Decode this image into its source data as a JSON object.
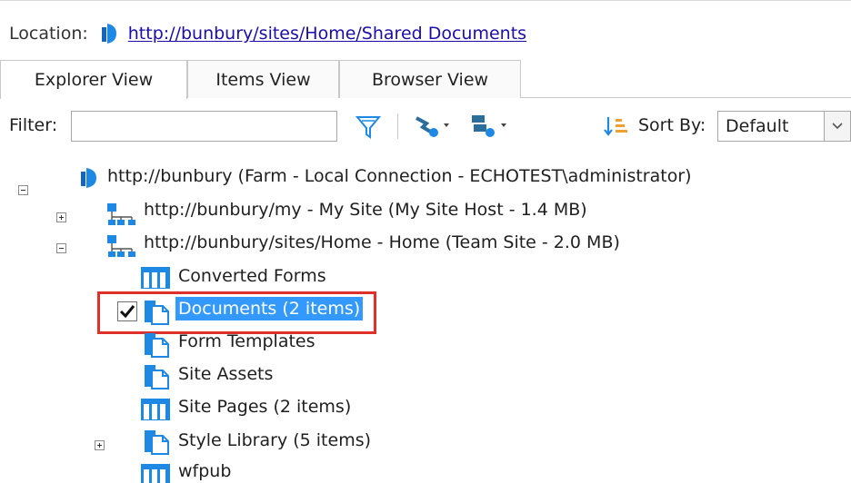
{
  "location": {
    "label": "Location:",
    "url": "http://bunbury/sites/Home/Shared Documents"
  },
  "tabs": [
    {
      "label": "Explorer View",
      "active": true
    },
    {
      "label": "Items View",
      "active": false
    },
    {
      "label": "Browser View",
      "active": false
    }
  ],
  "filter": {
    "label": "Filter:",
    "value": "",
    "placeholder": ""
  },
  "sort": {
    "label": "Sort By:",
    "selected": "Default"
  },
  "tree": {
    "root": "http://bunbury (Farm - Local Connection - ECHOTEST\\administrator)",
    "my_site": "http://bunbury/my - My Site (My Site Host - 1.4 MB)",
    "home_site": "http://bunbury/sites/Home - Home (Team Site - 2.0 MB)",
    "children": [
      {
        "label": "Converted Forms",
        "icon": "list-icon"
      },
      {
        "label": "Documents (2 items)",
        "icon": "document-library-icon",
        "selected": true,
        "checked": true
      },
      {
        "label": "Form Templates",
        "icon": "document-library-icon"
      },
      {
        "label": "Site Assets",
        "icon": "document-library-icon"
      },
      {
        "label": "Site Pages (2 items)",
        "icon": "list-icon"
      },
      {
        "label": "Style Library (5 items)",
        "icon": "document-library-icon",
        "expandable": true
      },
      {
        "label": "wfpub",
        "icon": "list-icon"
      }
    ]
  },
  "colors": {
    "accent": "#3399ff",
    "link": "#1a0dab",
    "highlight_border": "#e0302a",
    "icon_blue": "#1e88e5"
  }
}
